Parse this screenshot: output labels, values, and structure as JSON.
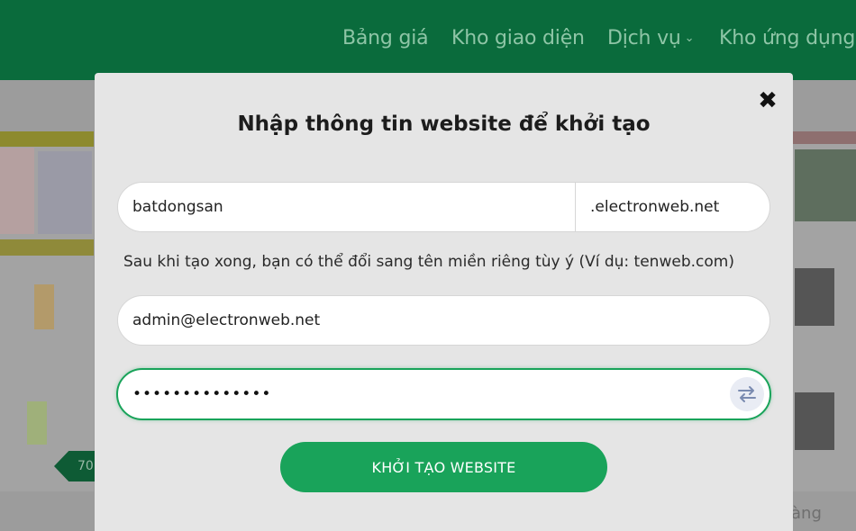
{
  "nav": {
    "items": [
      "Bảng giá",
      "Kho giao diện",
      "Dịch vụ",
      "Kho ứng dụng"
    ]
  },
  "background": {
    "promo_percent": "70",
    "bottom_word": "àng"
  },
  "modal": {
    "title": "Nhập thông tin website để khởi tạo",
    "domain": {
      "value": "batdongsan",
      "suffix": ".electronweb.net"
    },
    "hint": "Sau khi tạo xong, bạn có thể đổi sang tên miền riêng tùy ý (Ví dụ: tenweb.com)",
    "email": {
      "value": "admin@electronweb.net"
    },
    "password": {
      "value": "••••••••••••••"
    },
    "submit_label": "KHỞI TẠO WEBSITE",
    "close_symbol": "✖"
  },
  "colors": {
    "header_green": "#0a6b3c",
    "accent_green": "#19a35a",
    "overlay_gray": "#9c9c9c",
    "modal_bg": "#e5e5e5"
  },
  "icons": [
    "close-icon",
    "chevron-down-icon",
    "swap-arrows-icon"
  ]
}
